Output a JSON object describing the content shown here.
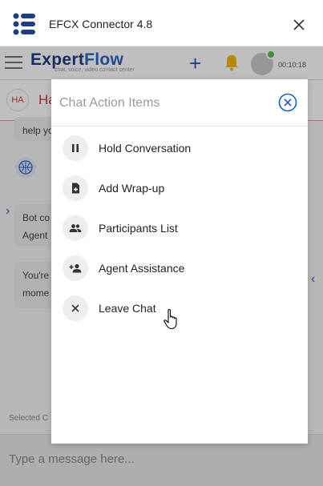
{
  "window": {
    "title": "EFCX Connector 4.8"
  },
  "app": {
    "brand_main": "Expert",
    "brand_accent": "Flow",
    "brand_tagline": "chat, voice, video contact center",
    "timer": "00:10:18"
  },
  "conversation": {
    "customer_initials": "HA",
    "customer_name_partial": "Ha",
    "snippets": [
      "help yo",
      "Bot co",
      "Agent",
      "You're",
      "mome"
    ],
    "selected_label": "Selected C"
  },
  "composer": {
    "placeholder": "Type a message here..."
  },
  "modal": {
    "title": "Chat Action Items",
    "actions": [
      {
        "label": "Hold Conversation",
        "icon": "pause-icon"
      },
      {
        "label": "Add Wrap-up",
        "icon": "wrapup-document-icon"
      },
      {
        "label": "Participants List",
        "icon": "participants-icon"
      },
      {
        "label": "Agent Assistance",
        "icon": "add-person-icon"
      },
      {
        "label": "Leave Chat",
        "icon": "close-icon"
      }
    ]
  },
  "colors": {
    "brand": "#1f3c88",
    "accent": "#2a63c9",
    "alert": "#d43a3a",
    "bell": "#f4b400",
    "online": "#5fbf3c"
  }
}
